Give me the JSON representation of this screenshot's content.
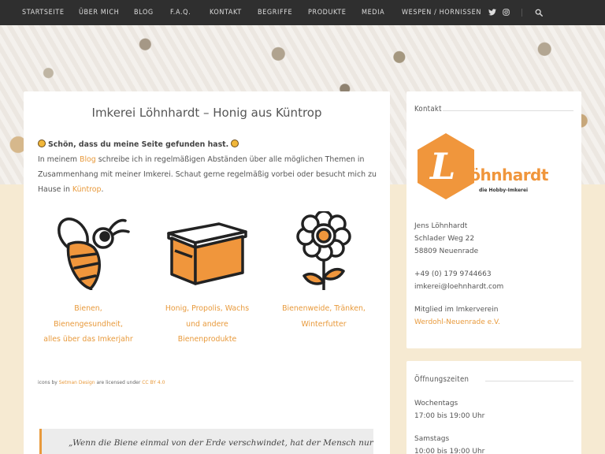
{
  "nav": {
    "items": [
      "STARTSEITE",
      "ÜBER MICH",
      "BLOG",
      "F.A.Q.",
      "KONTAKT",
      "BEGRIFFE",
      "PRODUKTE",
      "MEDIA",
      "WESPEN / HORNISSEN"
    ],
    "icons": [
      "twitter-icon",
      "instagram-icon",
      "search-icon"
    ]
  },
  "main": {
    "title": "Imkerei Löhnhardt – Honig aus Küntrop",
    "intro_bold": "Schön, dass du meine Seite gefunden hast.",
    "intro_p1_before": "In meinem ",
    "intro_blog_link": "Blog",
    "intro_p1_after": " schreibe ich in regelmäßigen Abständen über alle möglichen Themen in Zusammenhang mit meiner Imkerei. Schaut gerne regelmäßig vorbei oder besucht mich zu Hause in ",
    "intro_place_link": "Küntrop",
    "intro_p1_end": ".",
    "features": [
      {
        "line1": "Bienen,",
        "line2": "Bienengesundheit,",
        "line3": "alles über das Imkerjahr",
        "icon": "bee-icon"
      },
      {
        "line1": "Honig, Propolis, Wachs",
        "line2": "und andere",
        "line3": "Bienenprodukte",
        "icon": "beehive-box-icon"
      },
      {
        "line1": "Bienenweide, Tränken,",
        "line2": "Winterfutter",
        "line3": "",
        "icon": "flower-icon"
      }
    ],
    "credits_prefix": "icons by ",
    "credits_author": "Setman Design",
    "credits_middle": " are licensed under ",
    "credits_license": "CC BY 4.0",
    "quote": "„Wenn die Biene einmal von der Erde verschwindet, hat der Mensch nur"
  },
  "sidebar": {
    "contact": {
      "title": "Kontakt",
      "logo_text": "Löhnhardt",
      "logo_letter": "L",
      "logo_sub": "die Hobby-Imkerei",
      "name": "Jens Löhnhardt",
      "street": "Schlader Weg 22",
      "city": "58809 Neuenrade",
      "phone": "+49 (0) 179 9744663",
      "email": "imkerei@loehnhardt.com",
      "member_text": "Mitglied im Imkerverein",
      "member_link": "Werdohl-Neuenrade e.V."
    },
    "hours": {
      "title": "Öffnungszeiten",
      "weekday_label": "Wochentags",
      "weekday_time": "17:00 bis 19:00 Uhr",
      "saturday_label": "Samstags",
      "saturday_time": "10:00 bis 19:00 Uhr"
    }
  },
  "colors": {
    "accent": "#e89a3c",
    "nav_bg": "#2f2f2f",
    "page_bg": "#f6ead2"
  }
}
